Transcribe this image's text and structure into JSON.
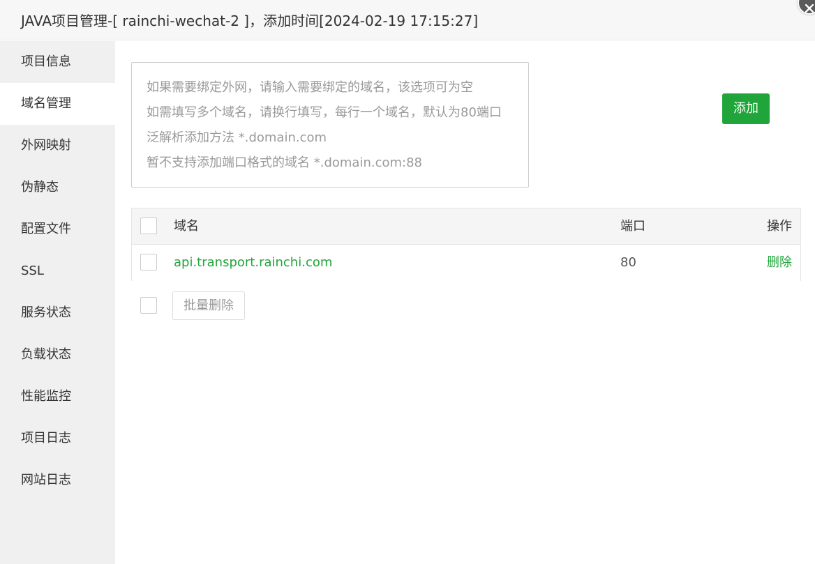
{
  "window": {
    "title": "JAVA项目管理-[ rainchi-wechat-2 ]，添加时间[2024-02-19 17:15:27]",
    "close_icon": "close-icon"
  },
  "sidebar": {
    "active_index": 1,
    "items": [
      {
        "label": "项目信息"
      },
      {
        "label": "域名管理"
      },
      {
        "label": "外网映射"
      },
      {
        "label": "伪静态"
      },
      {
        "label": "配置文件"
      },
      {
        "label": "SSL"
      },
      {
        "label": "服务状态"
      },
      {
        "label": "负载状态"
      },
      {
        "label": "性能监控"
      },
      {
        "label": "项目日志"
      },
      {
        "label": "网站日志"
      }
    ]
  },
  "domain_input": {
    "value": "",
    "placeholder_lines": [
      "如果需要绑定外网，请输入需要绑定的域名，该选项可为空",
      "如需填写多个域名，请换行填写，每行一个域名，默认为80端口",
      "泛解析添加方法 *.domain.com",
      "暂不支持添加端口格式的域名 *.domain.com:88"
    ]
  },
  "add_button": {
    "label": "添加"
  },
  "table": {
    "headers": {
      "domain": "域名",
      "port": "端口",
      "action": "操作"
    },
    "rows": [
      {
        "domain": "api.transport.rainchi.com",
        "port": "80",
        "action": "删除"
      }
    ]
  },
  "batch": {
    "delete_label": "批量删除"
  },
  "colors": {
    "accent": "#20a53a",
    "sidebar_bg": "#f0f0f0",
    "header_bg": "#f7f7f7"
  }
}
